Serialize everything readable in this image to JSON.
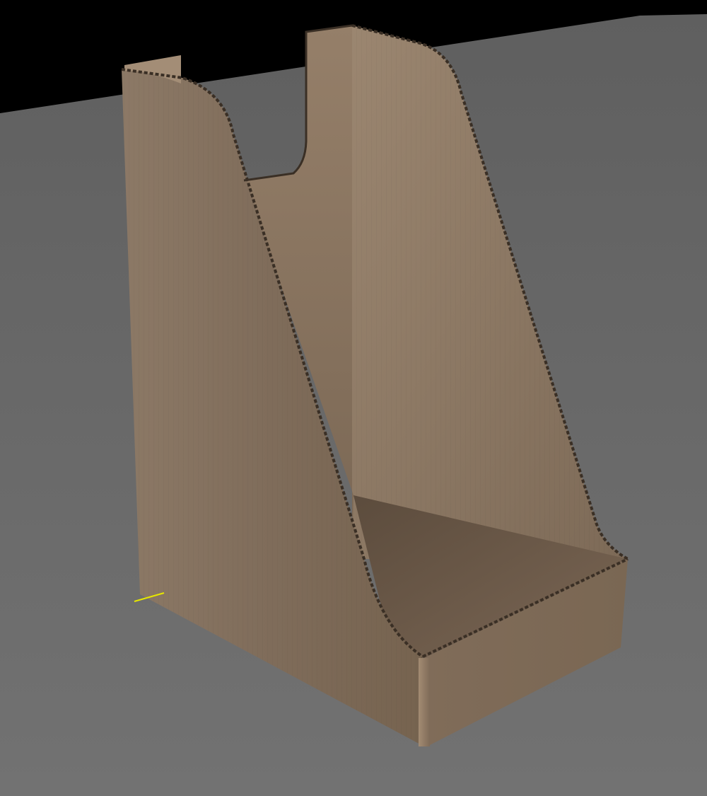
{
  "viewport": {
    "view": "perspective-3d",
    "background_color": "#000000",
    "ground_color": "#6a6a6a"
  },
  "model": {
    "object": "corrugated-cardboard-magazine-file",
    "material_color": "#8a7662",
    "cut_edge_color": "#3a2f25"
  },
  "gizmo": {
    "axis_color": "#e6e600"
  }
}
